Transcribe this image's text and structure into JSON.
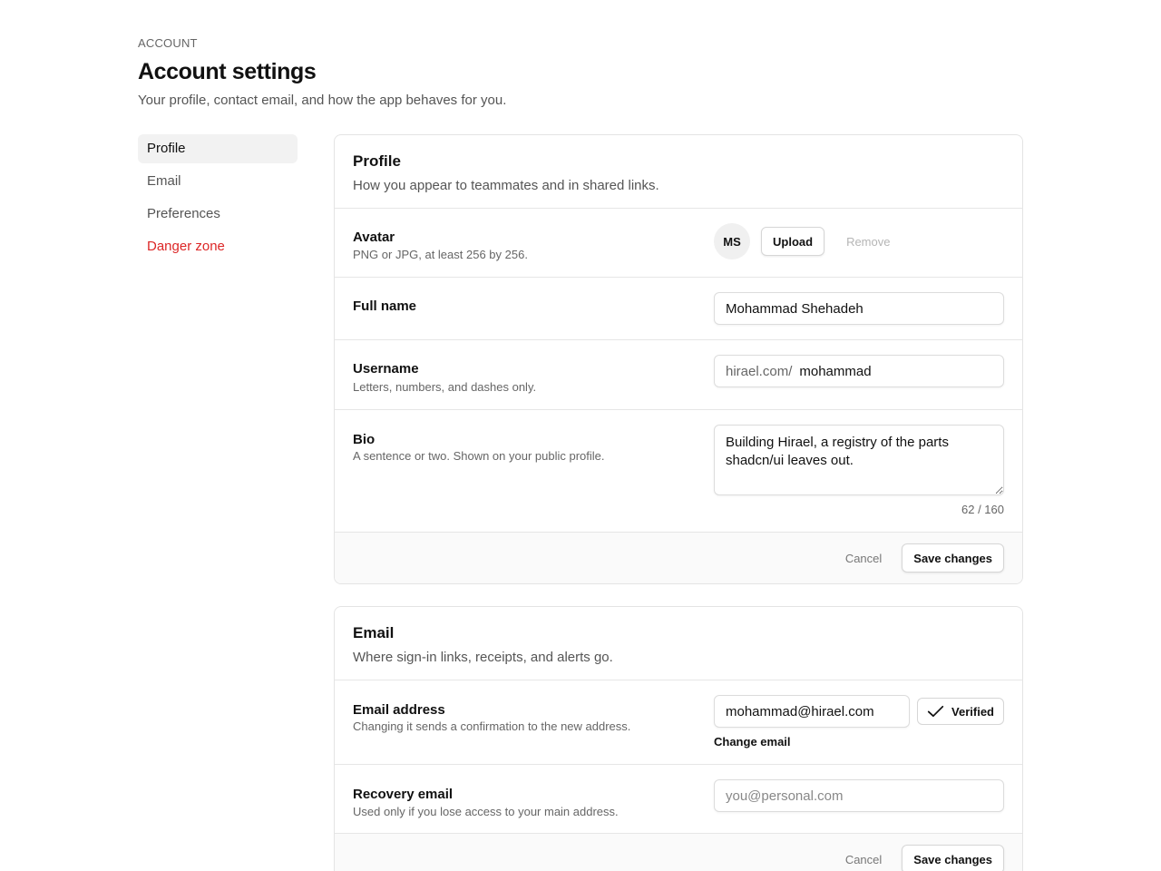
{
  "header": {
    "eyebrow": "ACCOUNT",
    "title": "Account settings",
    "subtitle": "Your profile, contact email, and how the app behaves for you."
  },
  "sidebar": {
    "items": [
      {
        "label": "Profile",
        "active": true
      },
      {
        "label": "Email"
      },
      {
        "label": "Preferences"
      },
      {
        "label": "Danger zone",
        "danger": true
      }
    ]
  },
  "profile": {
    "title": "Profile",
    "description": "How you appear to teammates and in shared links.",
    "avatar": {
      "label": "Avatar",
      "hint": "PNG or JPG, at least 256 by 256.",
      "initials": "MS",
      "upload_label": "Upload",
      "remove_label": "Remove"
    },
    "full_name": {
      "label": "Full name",
      "value": "Mohammad Shehadeh"
    },
    "username": {
      "label": "Username",
      "hint": "Letters, numbers, and dashes only.",
      "prefix": "hirael.com/",
      "value": "mohammad"
    },
    "bio": {
      "label": "Bio",
      "hint": "A sentence or two. Shown on your public profile.",
      "value": "Building Hirael, a registry of the parts shadcn/ui leaves out.",
      "counter": "62 / 160"
    },
    "cancel_label": "Cancel",
    "save_label": "Save changes"
  },
  "email": {
    "title": "Email",
    "description": "Where sign-in links, receipts, and alerts go.",
    "address": {
      "label": "Email address",
      "hint": "Changing it sends a confirmation to the new address.",
      "value": "mohammad@hirael.com",
      "verified_label": "Verified",
      "change_label": "Change email"
    },
    "recovery": {
      "label": "Recovery email",
      "hint": "Used only if you lose access to your main address.",
      "placeholder": "you@personal.com"
    },
    "cancel_label": "Cancel",
    "save_label": "Save changes"
  },
  "colors": {
    "danger": "#dc2626",
    "border": "#e4e4e4",
    "muted_text": "#666666"
  }
}
